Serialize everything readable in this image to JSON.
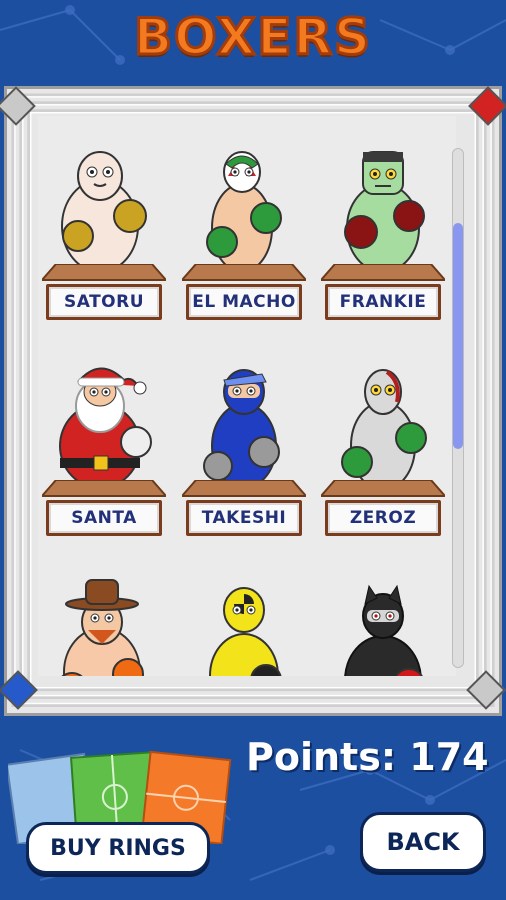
{
  "screen": {
    "title": "BOXERS",
    "colors": {
      "background": "#1d4fa0",
      "title": "#f47a1f",
      "nameplate_text": "#23317a",
      "nameplate_border": "#7a3c1c",
      "scroll_thumb": "#8a97ef"
    }
  },
  "boxers": [
    {
      "name": "SATORU",
      "icon": "bald-boxer-icon"
    },
    {
      "name": "EL MACHO",
      "icon": "luchador-boxer-icon"
    },
    {
      "name": "FRANKIE",
      "icon": "frankenstein-boxer-icon"
    },
    {
      "name": "SANTA",
      "icon": "santa-boxer-icon"
    },
    {
      "name": "TAKESHI",
      "icon": "ninja-boxer-icon"
    },
    {
      "name": "ZEROZ",
      "icon": "cyborg-boxer-icon"
    },
    {
      "name": "",
      "icon": "cowboy-boxer-icon"
    },
    {
      "name": "",
      "icon": "crash-dummy-boxer-icon"
    },
    {
      "name": "",
      "icon": "cat-woman-boxer-icon"
    }
  ],
  "footer": {
    "points_label": "Points:",
    "points_value": "174",
    "buy_rings_label": "BUY RINGS",
    "back_label": "BACK"
  }
}
